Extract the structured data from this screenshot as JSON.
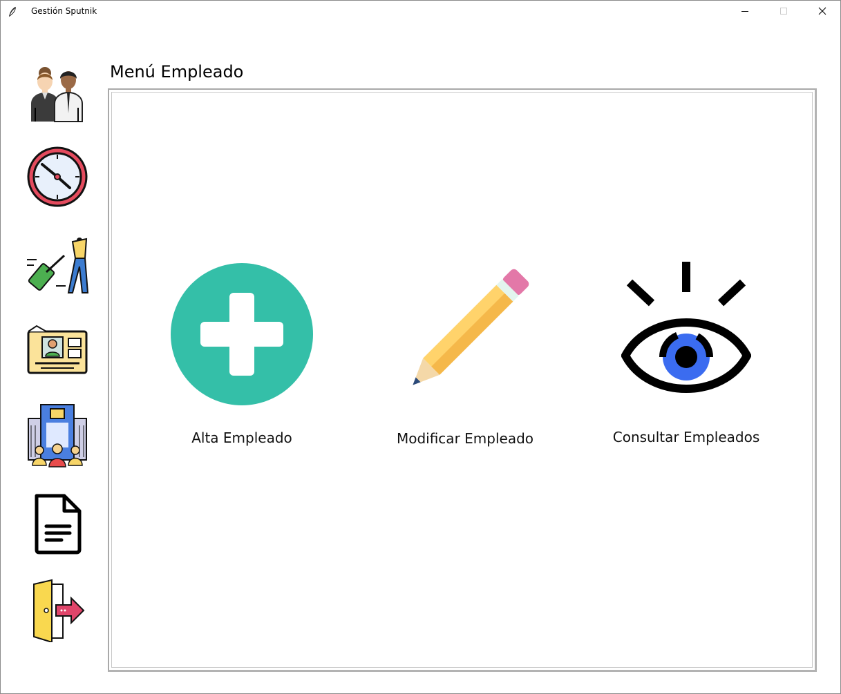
{
  "window": {
    "title": "Gestión Sputnik",
    "controls": [
      "minimize-icon",
      "maximize-icon",
      "close-icon"
    ]
  },
  "sidebar": {
    "items": [
      {
        "icon": "employees-icon"
      },
      {
        "icon": "clock-icon"
      },
      {
        "icon": "travel-icon"
      },
      {
        "icon": "id-card-icon"
      },
      {
        "icon": "company-icon"
      },
      {
        "icon": "document-icon"
      },
      {
        "icon": "exit-icon"
      }
    ]
  },
  "main": {
    "title": "Menú Empleado",
    "actions": [
      {
        "label": "Alta Empleado",
        "icon": "add-icon",
        "color": "#34bfa8"
      },
      {
        "label": "Modificar Empleado",
        "icon": "pencil-icon",
        "color": "#ffcf5b"
      },
      {
        "label": "Consultar Empleados",
        "icon": "eye-icon",
        "color": "#3b6cf0"
      }
    ]
  }
}
